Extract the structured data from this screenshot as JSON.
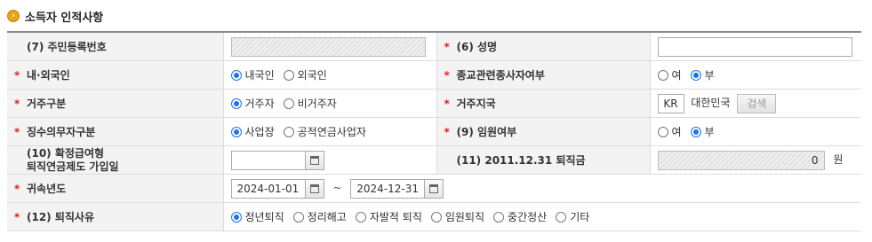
{
  "section": {
    "title": "소득자 인적사항"
  },
  "rows": {
    "resident_no": {
      "label": "(7) 주민등록번호",
      "value": ""
    },
    "name": {
      "label": "(6) 성명",
      "value": ""
    },
    "nationality": {
      "label": "내·외국인",
      "options": [
        "내국인",
        "외국인"
      ],
      "selected": "내국인"
    },
    "religion": {
      "label": "종교관련종사자여부",
      "options": [
        "여",
        "부"
      ],
      "selected": "부"
    },
    "residency": {
      "label": "거주구분",
      "options": [
        "거주자",
        "비거주자"
      ],
      "selected": "거주자"
    },
    "country": {
      "label": "거주지국",
      "code": "KR",
      "name": "대한민국",
      "search_label": "검색"
    },
    "withholding": {
      "label": "징수의무자구분",
      "options": [
        "사업장",
        "공적연금사업자"
      ],
      "selected": "사업장"
    },
    "executive": {
      "label": "(9) 임원여부",
      "options": [
        "여",
        "부"
      ],
      "selected": "부"
    },
    "db_pension": {
      "label_line1": "(10) 확정급여형",
      "label_line2": "퇴직연금제도 가입일",
      "value": ""
    },
    "severance_2011": {
      "label": "(11) 2011.12.31 퇴직금",
      "value": "0",
      "unit": "원"
    },
    "period": {
      "label": "귀속년도",
      "from": "2024-01-01",
      "to": "2024-12-31",
      "separator": "~"
    },
    "reason": {
      "label": "(12) 퇴직사유",
      "options": [
        "정년퇴직",
        "정리해고",
        "자발적 퇴직",
        "임원퇴직",
        "중간정산",
        "기타"
      ],
      "selected": "정년퇴직"
    }
  },
  "colors": {
    "required": "#dd2222",
    "radio_on": "#1a73e8",
    "label_bg": "#f3f3f3"
  }
}
